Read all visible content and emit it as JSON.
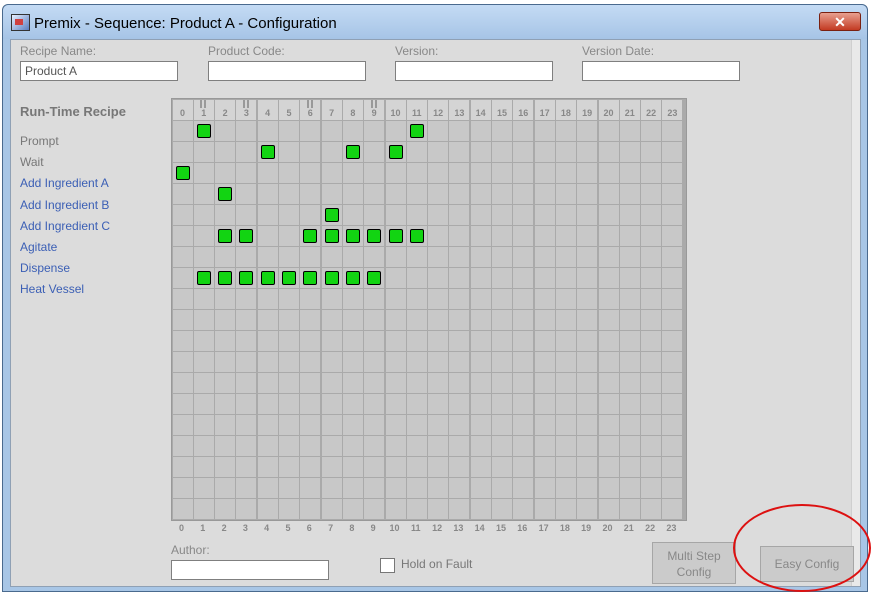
{
  "window": {
    "title": "Premix - Sequence: Product A - Configuration",
    "close_label": "✕"
  },
  "header_fields": {
    "recipe_name": {
      "label": "Recipe Name:",
      "value": "Product A"
    },
    "product_code": {
      "label": "Product Code:",
      "value": ""
    },
    "version": {
      "label": "Version:",
      "value": ""
    },
    "version_date": {
      "label": "Version Date:",
      "value": ""
    }
  },
  "runtime_recipe": {
    "title": "Run-Time Recipe",
    "rows": [
      "Prompt",
      "Wait",
      "Add Ingredient A",
      "Add Ingredient B",
      "Add Ingredient C",
      "Agitate",
      "Dispense",
      "Heat Vessel"
    ],
    "row_colors": [
      "#777777",
      "#777777",
      "#3b5fb5",
      "#3b5fb5",
      "#3b5fb5",
      "#3b5fb5",
      "#3b5fb5",
      "#3b5fb5"
    ]
  },
  "grid": {
    "step_numbers": [
      "0",
      "1",
      "2",
      "3",
      "4",
      "5",
      "6",
      "7",
      "8",
      "9",
      "10",
      "11",
      "12",
      "13",
      "14",
      "15",
      "16",
      "17",
      "18",
      "19",
      "20",
      "21",
      "22",
      "23"
    ],
    "pause_steps": [
      1,
      3,
      6,
      9
    ],
    "active_steps": [
      [
        1,
        11
      ],
      [
        4,
        8,
        10
      ],
      [
        0
      ],
      [
        2
      ],
      [
        7
      ],
      [
        2,
        3,
        6,
        7,
        8,
        9,
        10,
        11
      ],
      [],
      [
        1,
        2,
        3,
        4,
        5,
        6,
        7,
        8,
        9
      ]
    ],
    "active_color": "#12d412"
  },
  "footer": {
    "author": {
      "label": "Author:",
      "value": ""
    },
    "hold_on_fault": {
      "label": "Hold on Fault",
      "checked": false
    },
    "multi_step_config": "Multi Step Config",
    "easy_config": "Easy Config"
  }
}
